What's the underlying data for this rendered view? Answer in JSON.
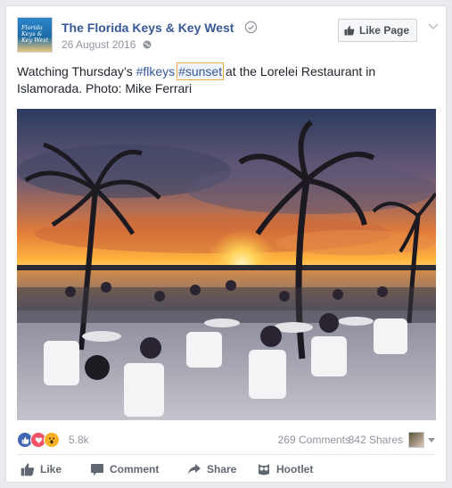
{
  "post": {
    "page_name": "The Florida Keys & Key West",
    "date": "26 August 2016",
    "avatar_text": "Florida Keys & Key West",
    "like_page_label": "Like Page",
    "text_before": "Watching Thursday’s ",
    "hashtag1": "#flkeys",
    "hashtag2": "#sunset",
    "text_after": " at the Lorelei Restaurant in Islamorada. Photo: Mike Ferrari"
  },
  "stats": {
    "reaction_count": "5.8k",
    "comments": "269 Comments",
    "shares": "842 Shares"
  },
  "actions": {
    "like": "Like",
    "comment": "Comment",
    "share": "Share",
    "hootlet": "Hootlet"
  },
  "colors": {
    "link": "#365899",
    "highlight_border": "#e3a64b",
    "like_blue": "#4267b2",
    "love_red": "#f25268",
    "wow_yellow": "#f7b125"
  }
}
